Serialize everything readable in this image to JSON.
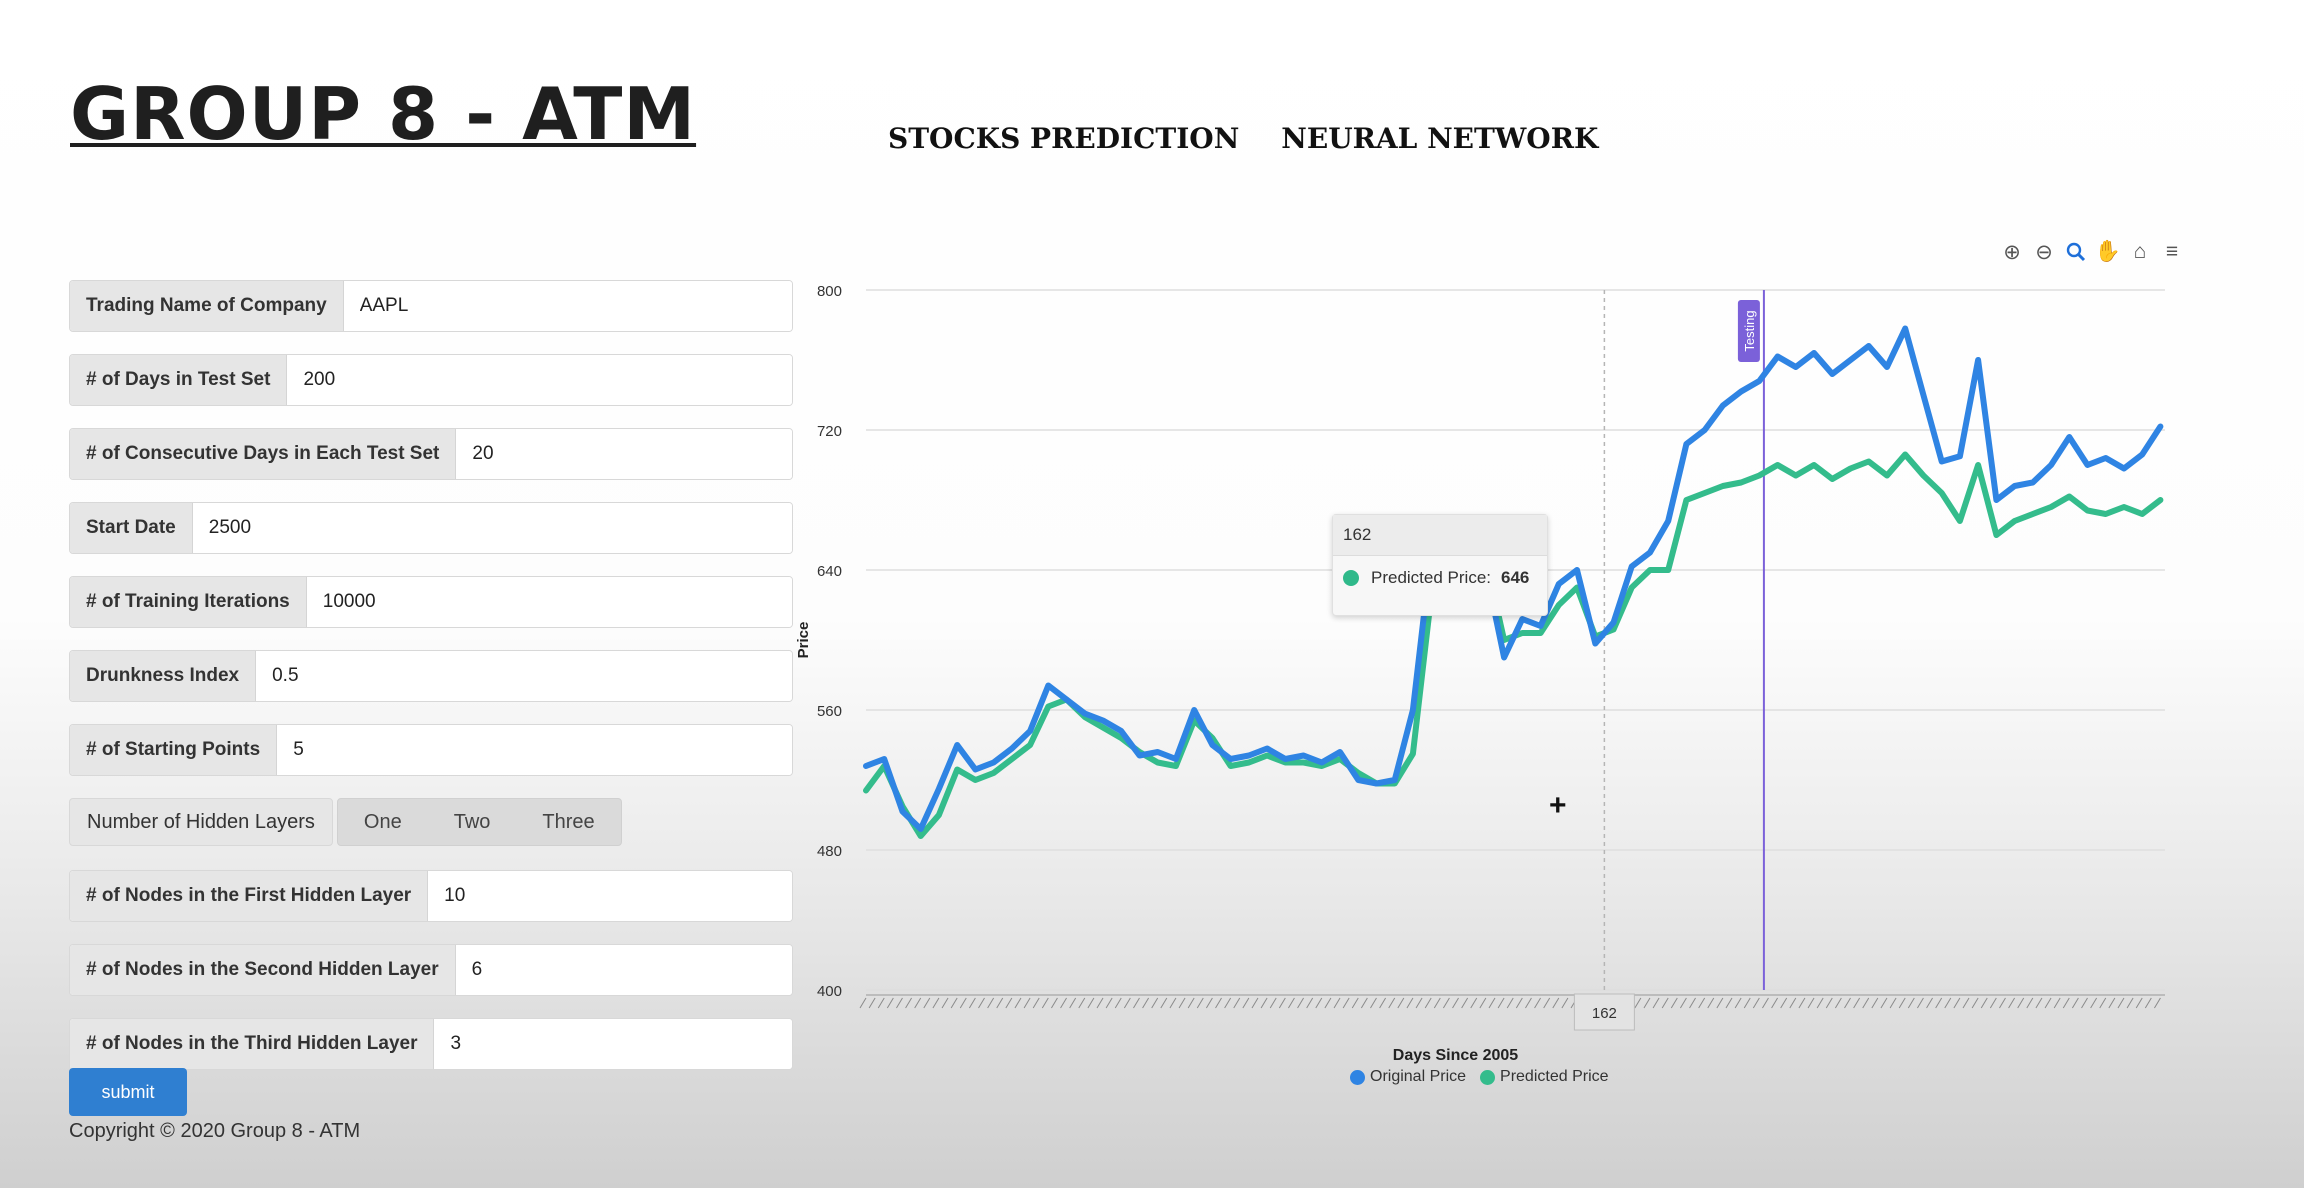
{
  "header": {
    "brand": "GROUP 8 - ATM",
    "nav": [
      "STOCKS PREDICTION",
      "NEURAL NETWORK"
    ]
  },
  "form": {
    "fields": [
      {
        "label": "Trading Name of Company",
        "value": "AAPL"
      },
      {
        "label": "# of Days in Test Set",
        "value": "200"
      },
      {
        "label": "# of Consecutive Days in Each Test Set",
        "value": "20"
      },
      {
        "label": "Start Date",
        "value": "2500"
      },
      {
        "label": "# of Training Iterations",
        "value": "10000"
      },
      {
        "label": "Drunkness Index",
        "value": "0.5"
      },
      {
        "label": "# of Starting Points",
        "value": "5"
      }
    ],
    "hidden_layers": {
      "label": "Number of Hidden Layers",
      "options": [
        "One",
        "Two",
        "Three"
      ]
    },
    "node_fields": [
      {
        "label": "# of Nodes in the First Hidden Layer",
        "value": "10"
      },
      {
        "label": "# of Nodes in the Second Hidden Layer",
        "value": "6"
      },
      {
        "label": "# of Nodes in the Third Hidden Layer",
        "value": "3"
      }
    ],
    "submit_label": "submit"
  },
  "footer": {
    "copyright": "Copyright © 2020 Group 8 - ATM"
  },
  "toolbar": {
    "icons": [
      "zoom-in-icon",
      "zoom-out-icon",
      "zoom-selection-icon",
      "pan-hand-icon",
      "home-reset-icon",
      "menu-icon"
    ]
  },
  "tooltip": {
    "header": "162",
    "series": "Predicted Price:",
    "value": "646"
  },
  "crosshair_label": "162",
  "annotation_label": "Testing",
  "colors": {
    "original": "#2f84e3",
    "predicted": "#34bc8c",
    "annotation": "#7b61d9"
  },
  "chart_data": {
    "type": "line",
    "xlabel": "Days Since 2005",
    "ylabel": "Price",
    "ylim": [
      400,
      800
    ],
    "yticks": [
      400,
      480,
      560,
      640,
      720,
      800
    ],
    "xlim": [
      0,
      285
    ],
    "grid": true,
    "legend": "bottom-center",
    "annotation_x": 197,
    "crosshair_x": 162,
    "series": [
      {
        "name": "Original Price",
        "x": [
          0,
          4,
          8,
          12,
          16,
          20,
          24,
          28,
          32,
          36,
          40,
          44,
          48,
          52,
          56,
          60,
          64,
          68,
          72,
          76,
          80,
          84,
          88,
          92,
          96,
          100,
          104,
          108,
          112,
          116,
          120,
          124,
          128,
          132,
          136,
          140,
          144,
          148,
          152,
          156,
          160,
          164,
          168,
          172,
          176,
          180,
          184,
          188,
          192,
          196,
          200,
          204,
          208,
          212,
          216,
          220,
          224,
          228,
          232,
          236,
          240,
          244,
          248,
          252,
          256,
          260,
          264,
          268,
          272,
          276,
          280,
          284
        ],
        "y": [
          528,
          532,
          502,
          492,
          515,
          540,
          526,
          530,
          538,
          548,
          574,
          566,
          558,
          554,
          548,
          534,
          536,
          532,
          560,
          540,
          532,
          534,
          538,
          532,
          534,
          530,
          536,
          520,
          518,
          520,
          560,
          650,
          660,
          660,
          640,
          590,
          612,
          608,
          632,
          640,
          598,
          610,
          642,
          650,
          668,
          712,
          720,
          734,
          742,
          748,
          762,
          756,
          764,
          752,
          760,
          768,
          756,
          778,
          740,
          702,
          705,
          760,
          680,
          688,
          690,
          700,
          716,
          700,
          704,
          698,
          706,
          722
        ]
      },
      {
        "name": "Predicted Price",
        "x": [
          0,
          4,
          8,
          12,
          16,
          20,
          24,
          28,
          32,
          36,
          40,
          44,
          48,
          52,
          56,
          60,
          64,
          68,
          72,
          76,
          80,
          84,
          88,
          92,
          96,
          100,
          104,
          108,
          112,
          116,
          120,
          124,
          128,
          132,
          136,
          140,
          144,
          148,
          152,
          156,
          160,
          164,
          168,
          172,
          176,
          180,
          184,
          188,
          192,
          196,
          200,
          204,
          208,
          212,
          216,
          220,
          224,
          228,
          232,
          236,
          240,
          244,
          248,
          252,
          256,
          260,
          264,
          268,
          272,
          276,
          280,
          284
        ],
        "y": [
          514,
          528,
          505,
          488,
          500,
          526,
          520,
          524,
          532,
          540,
          562,
          566,
          556,
          550,
          544,
          536,
          530,
          528,
          554,
          544,
          528,
          530,
          534,
          530,
          530,
          528,
          532,
          524,
          518,
          518,
          535,
          625,
          640,
          646,
          646,
          600,
          604,
          604,
          620,
          630,
          602,
          606,
          630,
          640,
          640,
          680,
          684,
          688,
          690,
          694,
          700,
          694,
          700,
          692,
          698,
          702,
          694,
          706,
          694,
          684,
          668,
          700,
          660,
          668,
          672,
          676,
          682,
          674,
          672,
          676,
          672,
          680
        ]
      }
    ]
  }
}
